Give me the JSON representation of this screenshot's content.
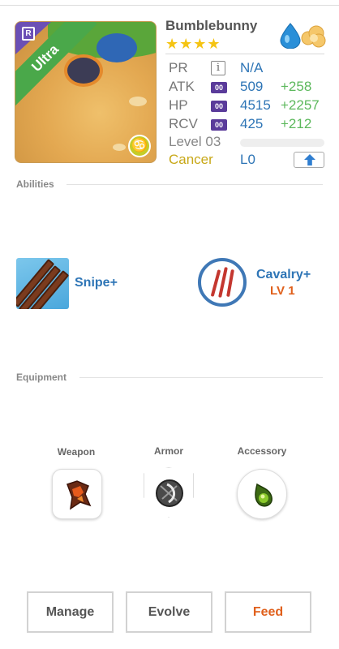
{
  "card": {
    "name": "Bumblebunny",
    "rarity": "Ultra",
    "rarity_badge": "R",
    "stars": "★★★★",
    "zodiac_symbol": "♋",
    "elements": [
      "water-drop-icon",
      "cloud-icon"
    ]
  },
  "stats": {
    "pr": {
      "label": "PR",
      "info": "i",
      "value": "N/A"
    },
    "atk": {
      "label": "ATK",
      "badge": "00",
      "value": "509",
      "bonus": "+258"
    },
    "hp": {
      "label": "HP",
      "badge": "00",
      "value": "4515",
      "bonus": "+2257"
    },
    "rcv": {
      "label": "RCV",
      "badge": "00",
      "value": "425",
      "bonus": "+212"
    },
    "level": {
      "label": "Level 03",
      "progress": 0
    },
    "sign": {
      "label": "Cancer",
      "value": "L0"
    }
  },
  "sections": {
    "abilities": "Abilities",
    "equipment": "Equipment"
  },
  "abilities": {
    "active": {
      "name": "Snipe+"
    },
    "passive": {
      "name": "Cavalry+",
      "level": "LV 1"
    }
  },
  "equipment": {
    "weapon": "Weapon",
    "armor": "Armor",
    "accessory": "Accessory"
  },
  "actions": {
    "manage": "Manage",
    "evolve": "Evolve",
    "feed": "Feed"
  },
  "colors": {
    "accent_blue": "#2e75b6",
    "bonus_green": "#5cb85c",
    "feed_orange": "#e0601c",
    "sign_gold": "#c8a818",
    "star_yellow": "#f5c413"
  }
}
